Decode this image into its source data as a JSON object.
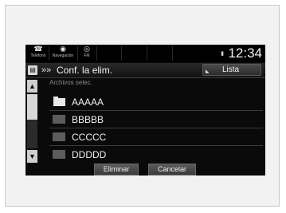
{
  "statusbar": {
    "items": [
      {
        "icon": "phone-icon",
        "glyph": "☎",
        "label": "Teléfono"
      },
      {
        "icon": "navigation-icon",
        "glyph": "◉",
        "label": "Navegación"
      },
      {
        "icon": "radio-icon",
        "glyph": "◎",
        "label": "FM"
      }
    ],
    "indicator_glyph": "▮",
    "clock": "12:34"
  },
  "titlebar": {
    "icon": "folder-menu-icon",
    "icon_glyph": "▤",
    "chevrons": "»»",
    "title": "Conf. la elim.",
    "lista_label": "Lista",
    "lista_corner_glyph": "◣"
  },
  "scroll": {
    "up_glyph": "▲",
    "down_glyph": "▼",
    "thumb_fraction": 0.45
  },
  "list": {
    "header": "Archivos selec.",
    "rows": [
      {
        "type": "folder",
        "label": "AAAAA"
      },
      {
        "type": "file",
        "label": "BBBBB"
      },
      {
        "type": "file",
        "label": "CCCCC"
      },
      {
        "type": "file",
        "label": "DDDDD"
      }
    ]
  },
  "buttons": {
    "eliminar": "Eliminar",
    "cancelar": "Cancelar"
  }
}
